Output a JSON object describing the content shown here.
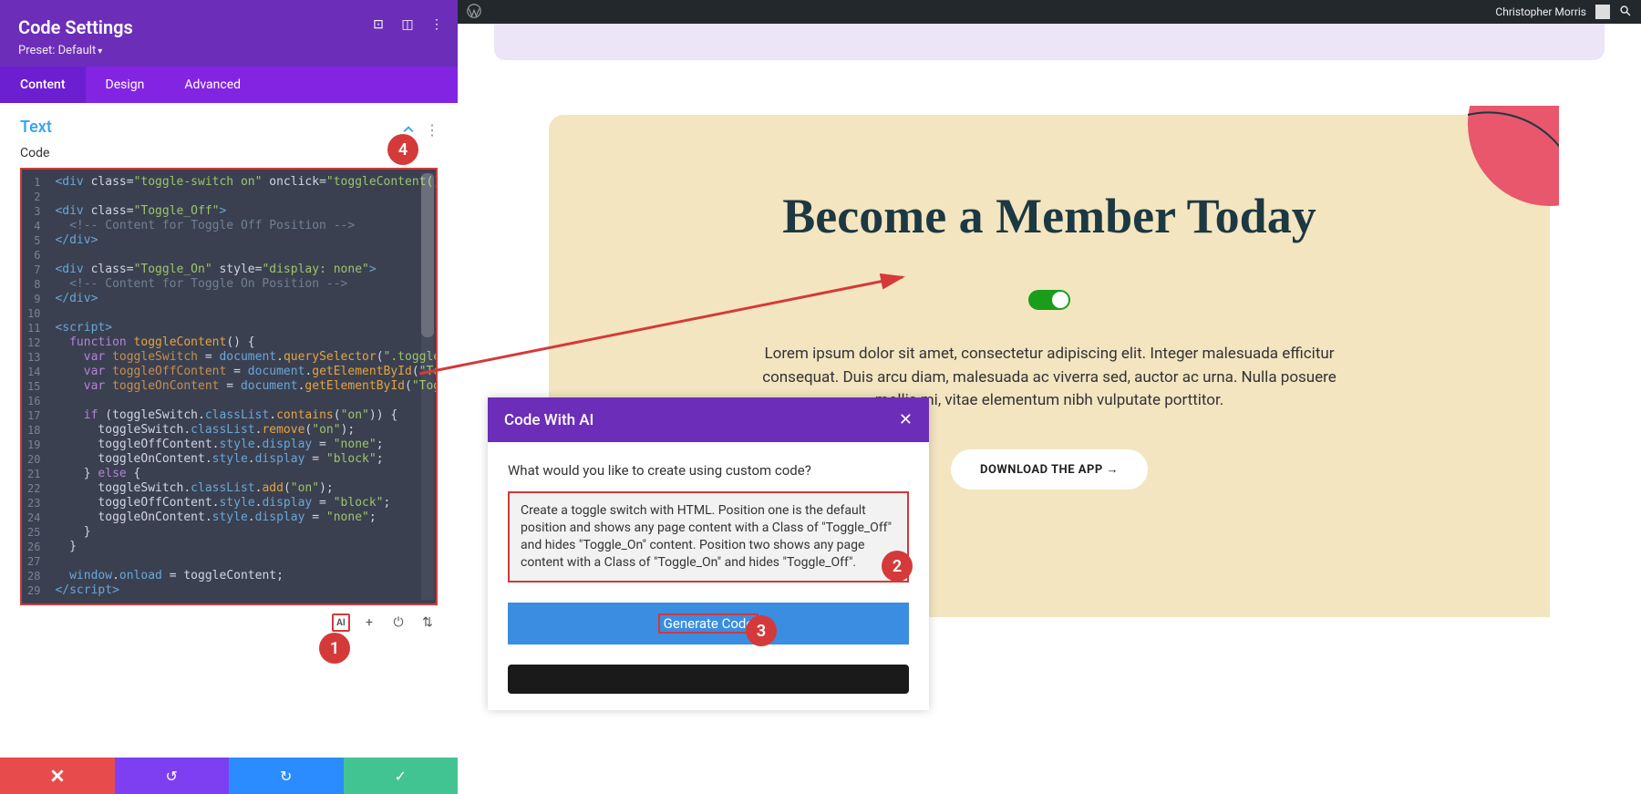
{
  "panel": {
    "title": "Code Settings",
    "preset_label": "Preset: Default",
    "tabs": [
      "Content",
      "Design",
      "Advanced"
    ],
    "active_tab": 0,
    "section_title": "Text",
    "code_label": "Code"
  },
  "code_lines": [
    {
      "n": 1,
      "html": "<span class='t-tag'>&lt;div</span> <span class='t-attr'>class=</span><span class='t-str'>\"toggle-switch on\"</span> <span class='t-attr'>onclick=</span><span class='t-str'>\"toggleContent()\"</span><span class='t-tag'>&gt;&lt;/div&gt;</span>"
    },
    {
      "n": 2,
      "html": ""
    },
    {
      "n": 3,
      "html": "<span class='t-tag'>&lt;div</span> <span class='t-attr'>class=</span><span class='t-str'>\"Toggle_Off\"</span><span class='t-tag'>&gt;</span>"
    },
    {
      "n": 4,
      "html": "  <span class='t-com'>&lt;!-- Content for Toggle Off Position --&gt;</span>"
    },
    {
      "n": 5,
      "html": "<span class='t-tag'>&lt;/div&gt;</span>"
    },
    {
      "n": 6,
      "html": ""
    },
    {
      "n": 7,
      "html": "<span class='t-tag'>&lt;div</span> <span class='t-attr'>class=</span><span class='t-str'>\"Toggle_On\"</span> <span class='t-attr'>style=</span><span class='t-str'>\"display: none\"</span><span class='t-tag'>&gt;</span>"
    },
    {
      "n": 8,
      "html": "  <span class='t-com'>&lt;!-- Content for Toggle On Position --&gt;</span>"
    },
    {
      "n": 9,
      "html": "<span class='t-tag'>&lt;/div&gt;</span>"
    },
    {
      "n": 10,
      "html": ""
    },
    {
      "n": 11,
      "html": "<span class='t-tag'>&lt;script&gt;</span>"
    },
    {
      "n": 12,
      "html": "  <span class='t-kw'>function</span> <span class='t-fn'>toggleContent</span>() {"
    },
    {
      "n": 13,
      "html": "    <span class='t-kw'>var</span> <span class='t-id'>toggleSwitch</span> = <span class='t-prop'>document</span>.<span class='t-fn'>querySelector</span>(<span class='t-str'>\".toggle-switch\"</span>);"
    },
    {
      "n": 14,
      "html": "    <span class='t-kw'>var</span> <span class='t-id'>toggleOffContent</span> = <span class='t-prop'>document</span>.<span class='t-fn'>getElementById</span>(<span class='t-str'>\"Toggle_Off\"</span>);"
    },
    {
      "n": 15,
      "html": "    <span class='t-kw'>var</span> <span class='t-id'>toggleOnContent</span> = <span class='t-prop'>document</span>.<span class='t-fn'>getElementById</span>(<span class='t-str'>\"Toggle_On\"</span>);"
    },
    {
      "n": 16,
      "html": ""
    },
    {
      "n": 17,
      "html": "    <span class='t-kw'>if</span> (toggleSwitch.<span class='t-prop'>classList</span>.<span class='t-fn'>contains</span>(<span class='t-str'>\"on\"</span>)) {"
    },
    {
      "n": 18,
      "html": "      toggleSwitch.<span class='t-prop'>classList</span>.<span class='t-fn'>remove</span>(<span class='t-str'>\"on\"</span>);"
    },
    {
      "n": 19,
      "html": "      toggleOffContent.<span class='t-prop'>style</span>.<span class='t-prop'>display</span> = <span class='t-str'>\"none\"</span>;"
    },
    {
      "n": 20,
      "html": "      toggleOnContent.<span class='t-prop'>style</span>.<span class='t-prop'>display</span> = <span class='t-str'>\"block\"</span>;"
    },
    {
      "n": 21,
      "html": "    } <span class='t-kw'>else</span> {"
    },
    {
      "n": 22,
      "html": "      toggleSwitch.<span class='t-prop'>classList</span>.<span class='t-fn'>add</span>(<span class='t-str'>\"on\"</span>);"
    },
    {
      "n": 23,
      "html": "      toggleOffContent.<span class='t-prop'>style</span>.<span class='t-prop'>display</span> = <span class='t-str'>\"block\"</span>;"
    },
    {
      "n": 24,
      "html": "      toggleOnContent.<span class='t-prop'>style</span>.<span class='t-prop'>display</span> = <span class='t-str'>\"none\"</span>;"
    },
    {
      "n": 25,
      "html": "    }"
    },
    {
      "n": 26,
      "html": "  }"
    },
    {
      "n": 27,
      "html": ""
    },
    {
      "n": 28,
      "html": "  <span class='t-prop'>window</span>.<span class='t-prop'>onload</span> = toggleContent;"
    },
    {
      "n": 29,
      "html": "<span class='t-tag'>&lt;/script&gt;</span>"
    }
  ],
  "editor_tools": {
    "ai": "AI"
  },
  "wp": {
    "user": "Christopher Morris"
  },
  "hero": {
    "title": "Become a Member Today",
    "text": "Lorem ipsum dolor sit amet, consectetur adipiscing elit. Integer malesuada efficitur consequat. Duis arcu diam, malesuada ac viverra sed, auctor ac urna. Nulla posuere mollis mi, vitae elementum nibh vulputate porttitor.",
    "cta": "DOWNLOAD THE APP →"
  },
  "ai_modal": {
    "title": "Code With AI",
    "question": "What would you like to create using custom code?",
    "prompt": "Create a toggle switch with HTML. Position one is the default position and shows any page content with a Class of \"Toggle_Off\" and hides \"Toggle_On\" content. Position two shows any page content with a Class of \"Toggle_On\" and hides \"Toggle_Off\".",
    "generate": "Generate Code"
  },
  "annotations": {
    "one": "1",
    "two": "2",
    "three": "3",
    "four": "4"
  }
}
